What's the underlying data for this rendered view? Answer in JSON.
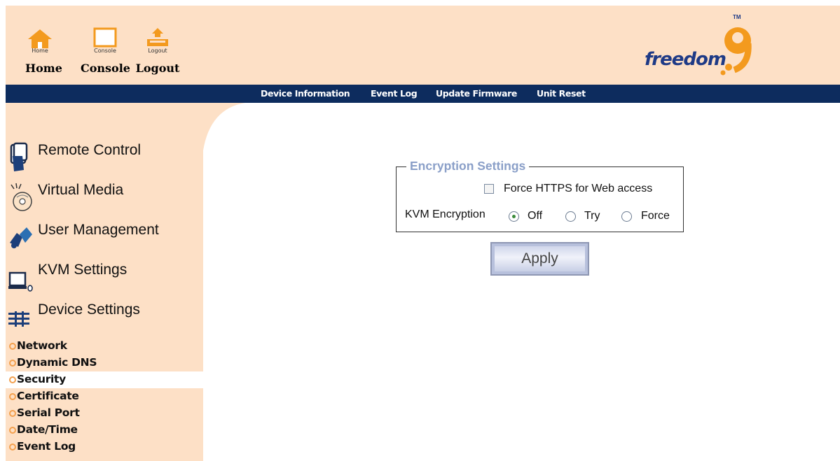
{
  "header": {
    "buttons": [
      {
        "id": "home",
        "small": "Home",
        "label": "Home"
      },
      {
        "id": "console",
        "small": "Console",
        "label": "Console"
      },
      {
        "id": "logout",
        "small": "Logout",
        "label": "Logout"
      }
    ],
    "logo": {
      "text": "freedom",
      "tm": "TM"
    }
  },
  "navbar": {
    "links": [
      "Device Information",
      "Event Log",
      "Update Firmware",
      "Unit Reset"
    ]
  },
  "sidebar": {
    "main_items": [
      {
        "label": "Remote Control",
        "icon": "hand-icon"
      },
      {
        "label": "Virtual Media",
        "icon": "cd-icon"
      },
      {
        "label": "User Management",
        "icon": "users-icon"
      },
      {
        "label": "KVM Settings",
        "icon": "monitor-icon"
      },
      {
        "label": "Device Settings",
        "icon": "settings-icon"
      }
    ],
    "sub_items": [
      "Network",
      "Dynamic DNS",
      "Security",
      "Certificate",
      "Serial Port",
      "Date/Time",
      "Event Log"
    ],
    "active_sub": "Security"
  },
  "encryption": {
    "legend": "Encryption Settings",
    "force_https_label": "Force HTTPS for Web access",
    "force_https_checked": false,
    "kvm_label": "KVM Encryption",
    "options": [
      "Off",
      "Try",
      "Force"
    ],
    "selected": "Off"
  },
  "apply_label": "Apply",
  "colors": {
    "header_bg": "#fde0c6",
    "navbar_bg": "#0d2c5e",
    "legend": "#8a9fc8",
    "logo_blue": "#1e3a86",
    "logo_orange": "#f39a1e"
  }
}
